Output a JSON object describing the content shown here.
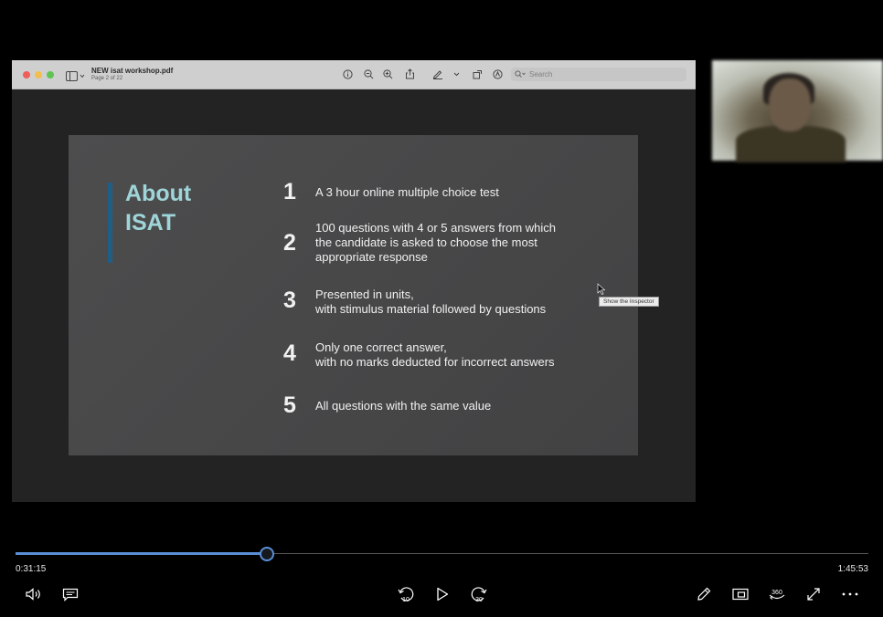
{
  "viewer": {
    "doc_title": "NEW isat workshop.pdf",
    "doc_page": "Page 2 of 22",
    "search_placeholder": "Search"
  },
  "slide": {
    "title_line1": "About",
    "title_line2": "ISAT",
    "items": [
      {
        "num": "1",
        "text": "A 3 hour online multiple choice test"
      },
      {
        "num": "2",
        "text": "100 questions with 4 or 5 answers from which\nthe candidate is asked to choose the most\nappropriate response"
      },
      {
        "num": "3",
        "text": "Presented in units,\nwith stimulus material followed by questions"
      },
      {
        "num": "4",
        "text": "Only one correct answer,\nwith no marks deducted for incorrect answers"
      },
      {
        "num": "5",
        "text": "All questions with the same value"
      }
    ]
  },
  "tooltip": "Show the Inspector",
  "player": {
    "current_time": "0:31:15",
    "total_time": "1:45:53",
    "progress_fraction": 0.295,
    "skip_back_label": "10",
    "skip_forward_label": "30",
    "vr_label": "360"
  },
  "colors": {
    "accent": "#5a8fd8",
    "slide_title": "#9fd5d8"
  }
}
